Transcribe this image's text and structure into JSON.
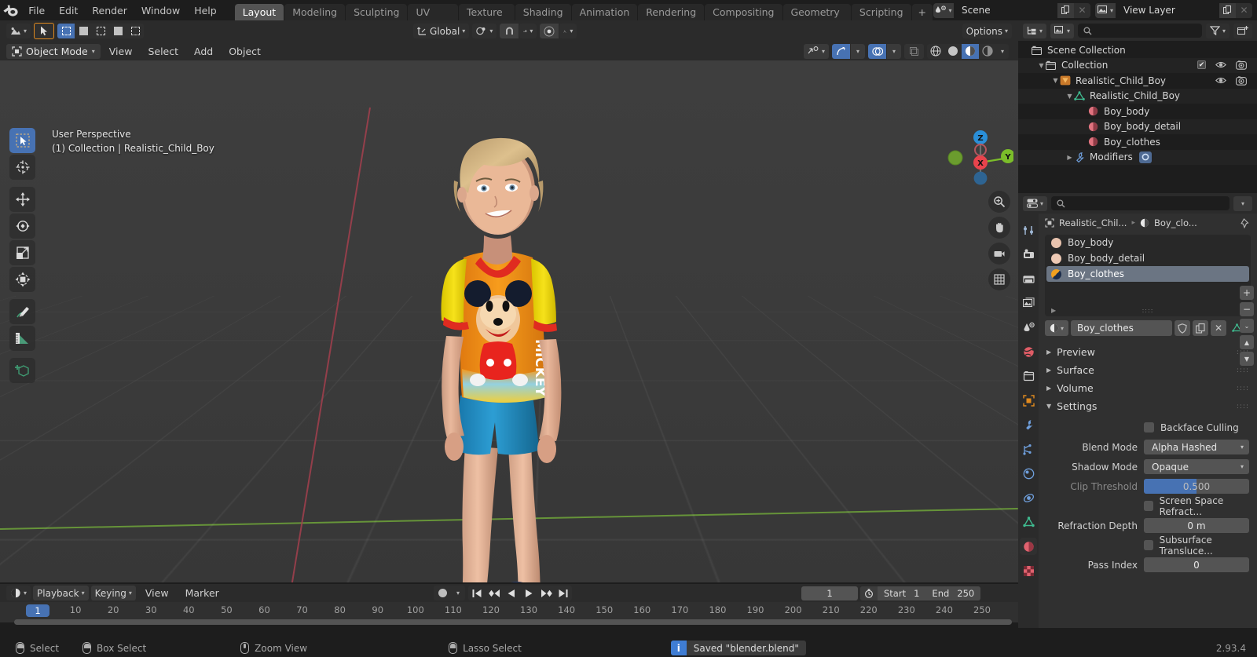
{
  "app": {
    "version": "2.93.4"
  },
  "topbar": {
    "logo_icon": "blender-logo-icon",
    "menus": [
      "File",
      "Edit",
      "Render",
      "Window",
      "Help"
    ],
    "workspace_tabs": [
      {
        "label": "Layout",
        "active": true
      },
      {
        "label": "Modeling",
        "active": false
      },
      {
        "label": "Sculpting",
        "active": false
      },
      {
        "label": "UV Editing",
        "active": false
      },
      {
        "label": "Texture Paint",
        "active": false
      },
      {
        "label": "Shading",
        "active": false
      },
      {
        "label": "Animation",
        "active": false
      },
      {
        "label": "Rendering",
        "active": false
      },
      {
        "label": "Compositing",
        "active": false
      },
      {
        "label": "Geometry Nodes",
        "active": false
      },
      {
        "label": "Scripting",
        "active": false
      }
    ],
    "add_workspace_label": "+",
    "scene": {
      "name": "Scene",
      "new_icon": "copy-icon",
      "unlink_icon": "x-icon"
    },
    "view_layer": {
      "name": "View Layer",
      "new_icon": "copy-icon",
      "unlink_icon": "x-icon"
    }
  },
  "viewport_header": {
    "editor_type_icon": "editor-type-icon",
    "select_tool_icon": "cursor-arrow-icon",
    "select_modes": [
      "set",
      "extend",
      "subtract",
      "invert",
      "intersect"
    ],
    "transform_orientation": "Global",
    "pivot_icon": "pivot-point-icon",
    "snap_icon": "magnet-icon",
    "snap_target_icon": "snap-increment-icon",
    "proportional_icon": "proportional-edit-icon",
    "falloff_icon": "smooth-falloff-icon",
    "options_label": "Options",
    "visibility_icon": "object-visibility-icon",
    "gizmo_icon": "gizmo-icon",
    "overlays_icon": "overlays-icon",
    "xray_icon": "xray-icon",
    "shading_modes": [
      "wireframe",
      "solid",
      "material-preview",
      "rendered"
    ],
    "shading_active": "material-preview"
  },
  "viewport_tools": {
    "mode": "Object Mode",
    "mode_icon": "object-mode-icon",
    "menus": [
      "View",
      "Select",
      "Add",
      "Object"
    ]
  },
  "viewport": {
    "overlay_line1": "User Perspective",
    "overlay_line2": "(1) Collection | Realistic_Child_Boy",
    "toolbar": [
      {
        "name": "tweak-tool",
        "icon": "cursor-arrow-icon",
        "active": true
      },
      {
        "name": "cursor-tool",
        "icon": "3d-cursor-icon",
        "active": false
      },
      {
        "name": "move-tool",
        "icon": "move-icon",
        "active": false
      },
      {
        "name": "rotate-tool",
        "icon": "rotate-icon",
        "active": false
      },
      {
        "name": "scale-tool",
        "icon": "scale-icon",
        "active": false
      },
      {
        "name": "transform-tool",
        "icon": "transform-icon",
        "active": false
      },
      {
        "name": "annotate-tool",
        "icon": "pencil-icon",
        "active": false
      },
      {
        "name": "measure-tool",
        "icon": "ruler-icon",
        "active": false
      },
      {
        "name": "add-cube-tool",
        "icon": "add-cube-icon",
        "active": false
      }
    ],
    "gizmo_axes": [
      "Z",
      "X",
      "Y"
    ],
    "nav_buttons": [
      "zoom-icon",
      "pan-hand-icon",
      "camera-icon",
      "grid-ortho-icon"
    ],
    "object_name": "Realistic_Child_Boy"
  },
  "outliner": {
    "display_mode_icon": "outliner-display-icon",
    "filter_id_icon": "view-layer-icon",
    "search_placeholder": "",
    "filter_icon": "funnel-icon",
    "new_collection_icon": "new-collection-icon",
    "rows": [
      {
        "label": "Scene Collection",
        "indent": 0,
        "icon": "collection-icon",
        "disclosure": "",
        "checkbox": false,
        "eye": false,
        "camera": false
      },
      {
        "label": "Collection",
        "indent": 1,
        "icon": "collection-icon",
        "disclosure": "▼",
        "checkbox": true,
        "eye": true,
        "camera": true
      },
      {
        "label": "Realistic_Child_Boy",
        "indent": 2,
        "icon": "object-empty-icon",
        "disclosure": "▼",
        "checkbox": false,
        "eye": true,
        "camera": true
      },
      {
        "label": "Realistic_Child_Boy",
        "indent": 3,
        "icon": "mesh-data-icon",
        "disclosure": "▼",
        "checkbox": false,
        "eye": false,
        "camera": false
      },
      {
        "label": "Boy_body",
        "indent": 4,
        "icon": "material-icon",
        "disclosure": "",
        "checkbox": false,
        "eye": false,
        "camera": false
      },
      {
        "label": "Boy_body_detail",
        "indent": 4,
        "icon": "material-icon",
        "disclosure": "",
        "checkbox": false,
        "eye": false,
        "camera": false
      },
      {
        "label": "Boy_clothes",
        "indent": 4,
        "icon": "material-icon",
        "disclosure": "",
        "checkbox": false,
        "eye": false,
        "camera": false
      },
      {
        "label": "Modifiers",
        "indent": 3,
        "icon": "wrench-icon",
        "disclosure": "▶",
        "checkbox": false,
        "eye": false,
        "camera": false,
        "badge": "subsurf-icon"
      }
    ]
  },
  "properties": {
    "editor_type_icon": "properties-editor-icon",
    "search_placeholder": "",
    "options_icon": "chevron-down-icon",
    "tabs": [
      {
        "name": "tool",
        "icon": "tool-icon",
        "active": false
      },
      {
        "name": "render",
        "icon": "render-camera-icon",
        "active": false
      },
      {
        "name": "output",
        "icon": "printer-icon",
        "active": false
      },
      {
        "name": "view-layer",
        "icon": "images-icon",
        "active": false
      },
      {
        "name": "scene",
        "icon": "scene-cone-icon",
        "active": false
      },
      {
        "name": "world",
        "icon": "world-icon",
        "active": false
      },
      {
        "name": "collection",
        "icon": "collection-box-icon",
        "active": false
      },
      {
        "name": "object",
        "icon": "object-square-icon",
        "active": false
      },
      {
        "name": "modifiers",
        "icon": "wrench-icon",
        "active": false
      },
      {
        "name": "particles",
        "icon": "particles-icon",
        "active": false
      },
      {
        "name": "physics",
        "icon": "physics-icon",
        "active": false
      },
      {
        "name": "constraints",
        "icon": "constraints-icon",
        "active": false
      },
      {
        "name": "data",
        "icon": "mesh-data-icon",
        "active": false
      },
      {
        "name": "material",
        "icon": "material-icon",
        "active": true
      },
      {
        "name": "texture",
        "icon": "texture-checker-icon",
        "active": false
      }
    ],
    "breadcrumb": {
      "object": "Realistic_Chil...",
      "material": "Boy_clo...",
      "pin_icon": "pin-icon"
    },
    "material_slots": [
      {
        "name": "Boy_body",
        "color": "#e8c3ae",
        "selected": false
      },
      {
        "name": "Boy_body_detail",
        "color": "#edc9b4",
        "selected": false
      },
      {
        "name": "Boy_clothes",
        "color": "#f0a020",
        "selected": true
      }
    ],
    "slot_buttons": [
      "+",
      "−",
      "⌄",
      "▲",
      "▼"
    ],
    "material_name": "Boy_clothes",
    "material_shield_icon": "shield-icon",
    "material_copy_icon": "copy-icon",
    "material_x_icon": "x-icon",
    "material_browse_icon": "material-browse-icon",
    "panels": [
      {
        "label": "Preview",
        "open": false
      },
      {
        "label": "Surface",
        "open": false
      },
      {
        "label": "Volume",
        "open": false
      },
      {
        "label": "Settings",
        "open": true
      }
    ],
    "settings": {
      "backface_culling": {
        "label": "Backface Culling",
        "checked": false
      },
      "blend_mode": {
        "label": "Blend Mode",
        "value": "Alpha Hashed"
      },
      "shadow_mode": {
        "label": "Shadow Mode",
        "value": "Opaque"
      },
      "clip_threshold": {
        "label": "Clip Threshold",
        "value": "0.500",
        "fill_percent": 50,
        "enabled": false
      },
      "screen_space_refraction": {
        "label": "Screen Space Refract...",
        "checked": false
      },
      "refraction_depth": {
        "label": "Refraction Depth",
        "value": "0 m"
      },
      "subsurface_translucency": {
        "label": "Subsurface Transluce...",
        "checked": false
      },
      "pass_index": {
        "label": "Pass Index",
        "value": "0"
      }
    }
  },
  "timeline": {
    "editor_icon": "timeline-editor-icon",
    "menus": [
      "Playback",
      "Keying",
      "View",
      "Marker"
    ],
    "record_icon": "record-icon",
    "playback_buttons": [
      "jump-start-icon",
      "prev-keyframe-icon",
      "play-reverse-icon",
      "play-icon",
      "next-keyframe-icon",
      "jump-end-icon"
    ],
    "current_frame": "1",
    "use_preview_range_icon": "stopwatch-icon",
    "start_label": "Start",
    "start_value": "1",
    "end_label": "End",
    "end_value": "250",
    "ticks": [
      "1",
      "10",
      "20",
      "30",
      "40",
      "50",
      "60",
      "70",
      "80",
      "90",
      "100",
      "110",
      "120",
      "130",
      "140",
      "150",
      "160",
      "170",
      "180",
      "190",
      "200",
      "210",
      "220",
      "230",
      "240",
      "250"
    ],
    "playhead_frame": "1"
  },
  "status_bar": {
    "items": [
      {
        "icon": "mouse-left-icon",
        "label": "Select"
      },
      {
        "icon": "mouse-left-drag-icon",
        "label": "Box Select"
      },
      {
        "icon": "mouse-middle-icon",
        "label": "Zoom View"
      },
      {
        "icon": "mouse-right-drag-icon",
        "label": "Lasso Select"
      }
    ],
    "report": {
      "icon": "info-icon",
      "text": "Saved \"blender.blend\""
    },
    "version": "2.93.4"
  },
  "colors": {
    "accent_blue": "#4772b3",
    "header": "#2b2b2b",
    "background": "#1d1d1d",
    "viewport": "#3b3b3b",
    "axis_green": "#6a9c3a",
    "axis_red": "#a33f4d"
  }
}
